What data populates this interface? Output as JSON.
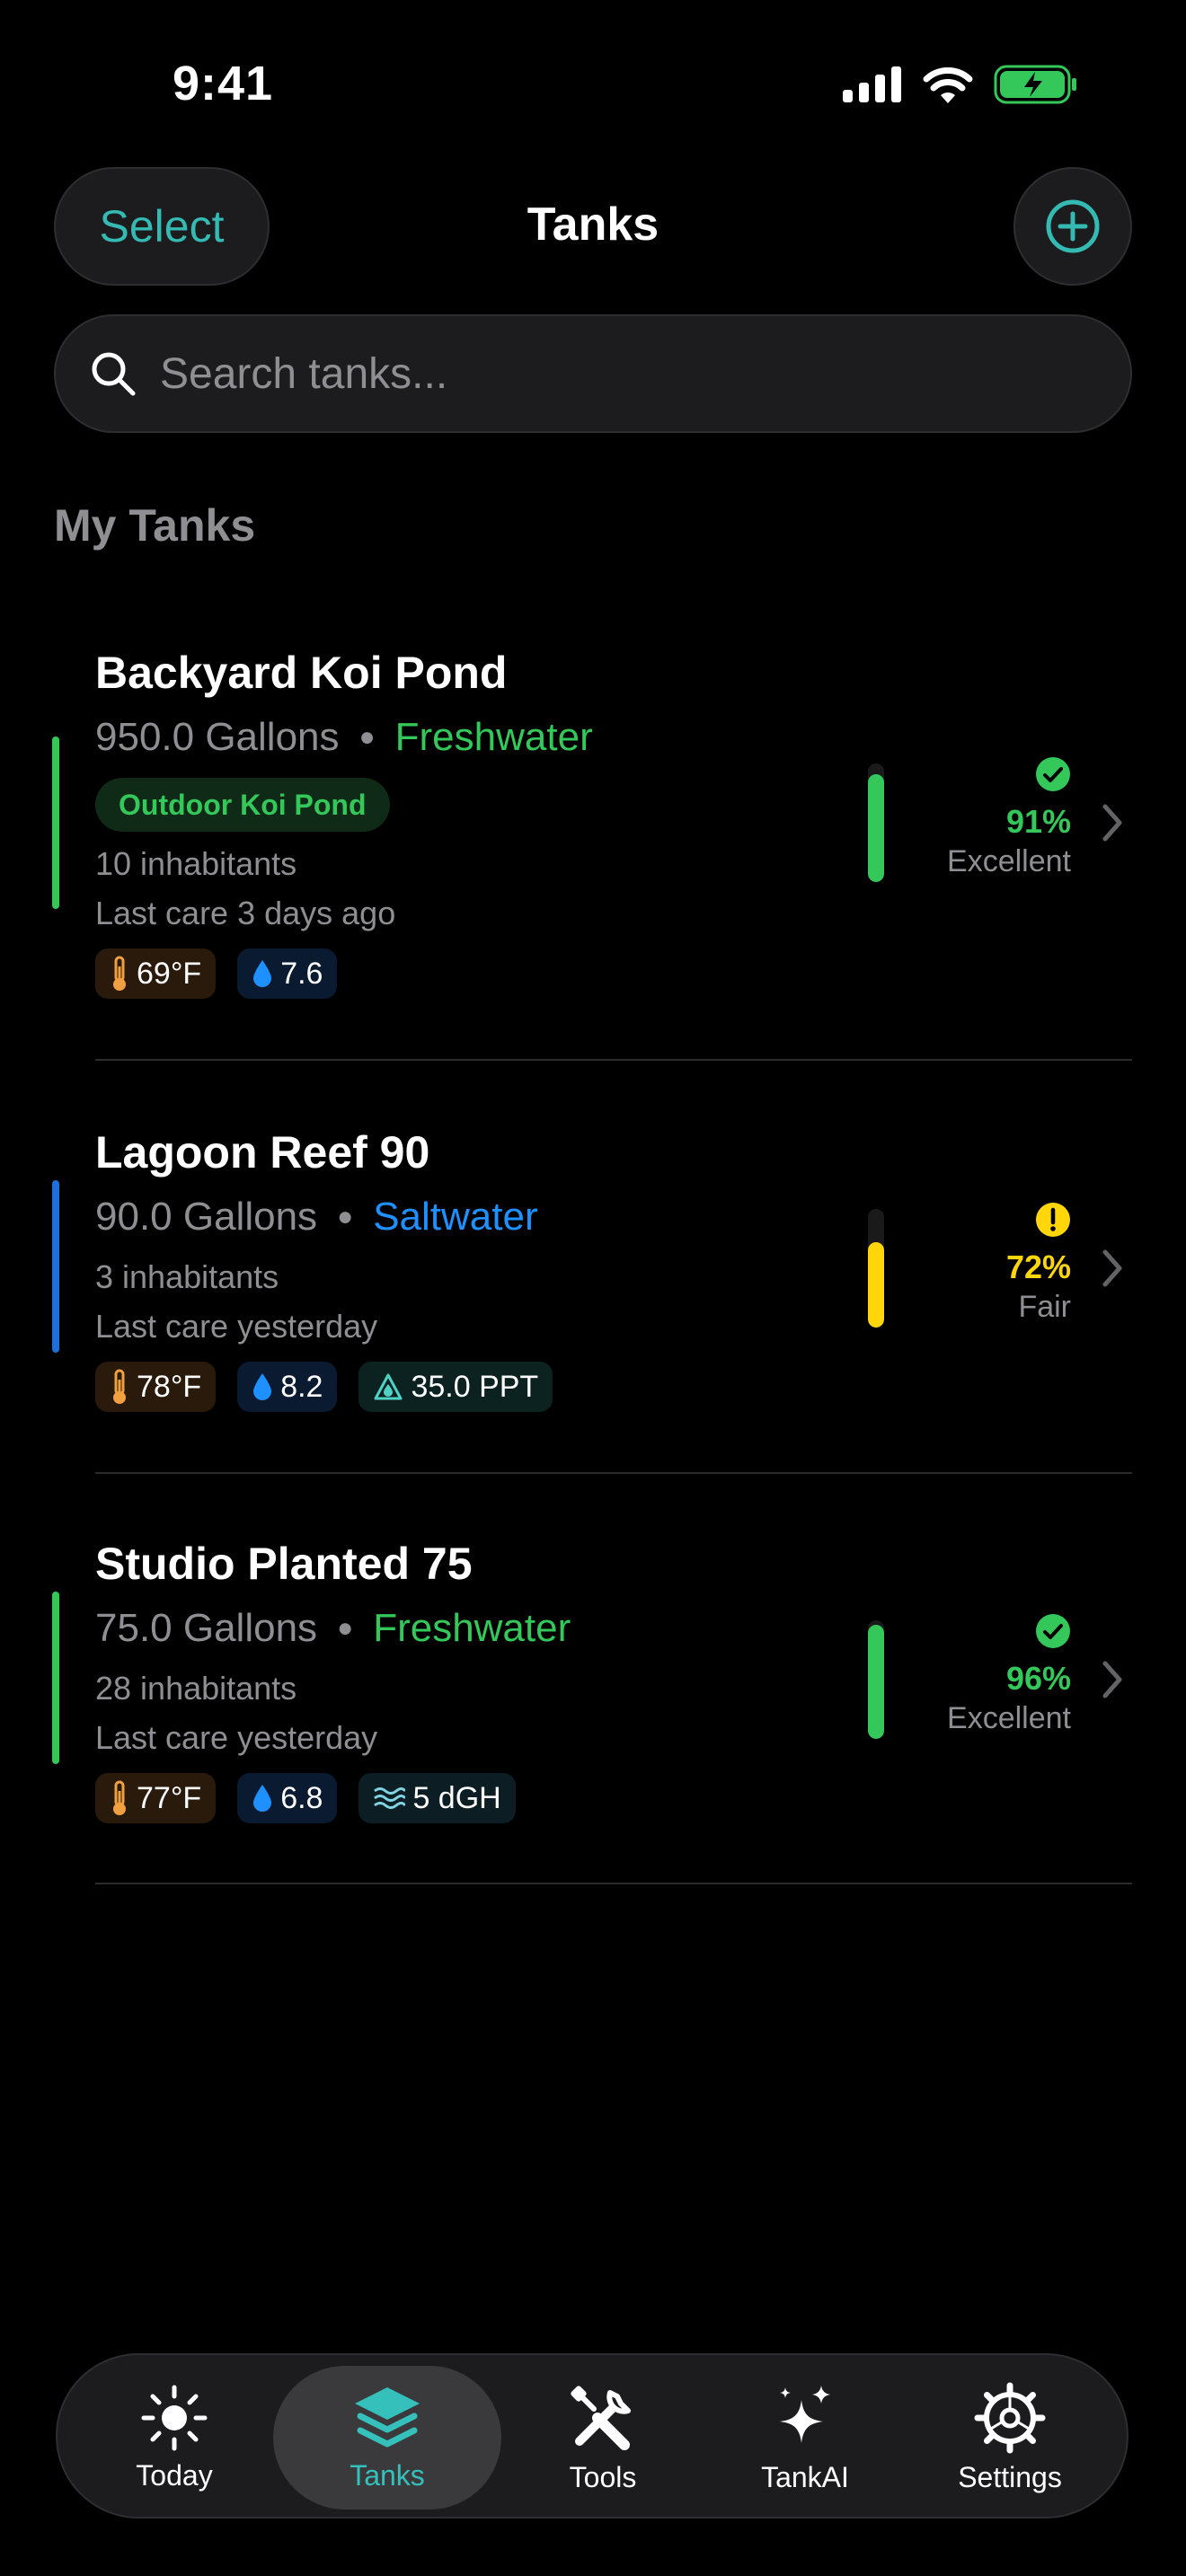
{
  "status_bar": {
    "time": "9:41"
  },
  "header": {
    "select_label": "Select",
    "title": "Tanks",
    "add_icon": "plus-circle-icon"
  },
  "search": {
    "placeholder": "Search tanks..."
  },
  "section_title": "My Tanks",
  "colors": {
    "accent": "#35b9b3",
    "freshwater": "#34c759",
    "saltwater": "#1e90ff",
    "fair": "#ffd60a"
  },
  "tanks": [
    {
      "name": "Backyard Koi Pond",
      "volume": "950.0 Gallons",
      "water_type": "Freshwater",
      "tag": "Outdoor Koi Pond",
      "inhabitants": "10 inhabitants",
      "last_care": "Last care 3 days ago",
      "params": [
        {
          "kind": "temperature",
          "icon": "thermometer-icon",
          "value": "69°F"
        },
        {
          "kind": "ph",
          "icon": "drop-icon",
          "value": "7.6"
        }
      ],
      "health_pct_text": "91%",
      "health_fraction": 0.91,
      "health_label": "Excellent",
      "health_icon": "check-circle-icon"
    },
    {
      "name": "Lagoon Reef 90",
      "volume": "90.0 Gallons",
      "water_type": "Saltwater",
      "inhabitants": "3 inhabitants",
      "last_care": "Last care yesterday",
      "params": [
        {
          "kind": "temperature",
          "icon": "thermometer-icon",
          "value": "78°F"
        },
        {
          "kind": "ph",
          "icon": "drop-icon",
          "value": "8.2"
        },
        {
          "kind": "salinity",
          "icon": "salinity-triangle-icon",
          "value": "35.0 PPT"
        }
      ],
      "health_pct_text": "72%",
      "health_fraction": 0.72,
      "health_label": "Fair",
      "health_icon": "exclamation-circle-icon"
    },
    {
      "name": "Studio Planted 75",
      "volume": "75.0 Gallons",
      "water_type": "Freshwater",
      "inhabitants": "28 inhabitants",
      "last_care": "Last care yesterday",
      "params": [
        {
          "kind": "temperature",
          "icon": "thermometer-icon",
          "value": "77°F"
        },
        {
          "kind": "ph",
          "icon": "drop-icon",
          "value": "6.8"
        },
        {
          "kind": "hardness",
          "icon": "waves-icon",
          "value": "5 dGH"
        }
      ],
      "health_pct_text": "96%",
      "health_fraction": 0.96,
      "health_label": "Excellent",
      "health_icon": "check-circle-icon"
    }
  ],
  "tab_bar": {
    "active": "Tanks",
    "items": [
      {
        "label": "Today",
        "icon": "sun-icon"
      },
      {
        "label": "Tanks",
        "icon": "layers-icon"
      },
      {
        "label": "Tools",
        "icon": "tools-icon"
      },
      {
        "label": "TankAI",
        "icon": "sparkles-icon"
      },
      {
        "label": "Settings",
        "icon": "gear-icon"
      }
    ]
  }
}
